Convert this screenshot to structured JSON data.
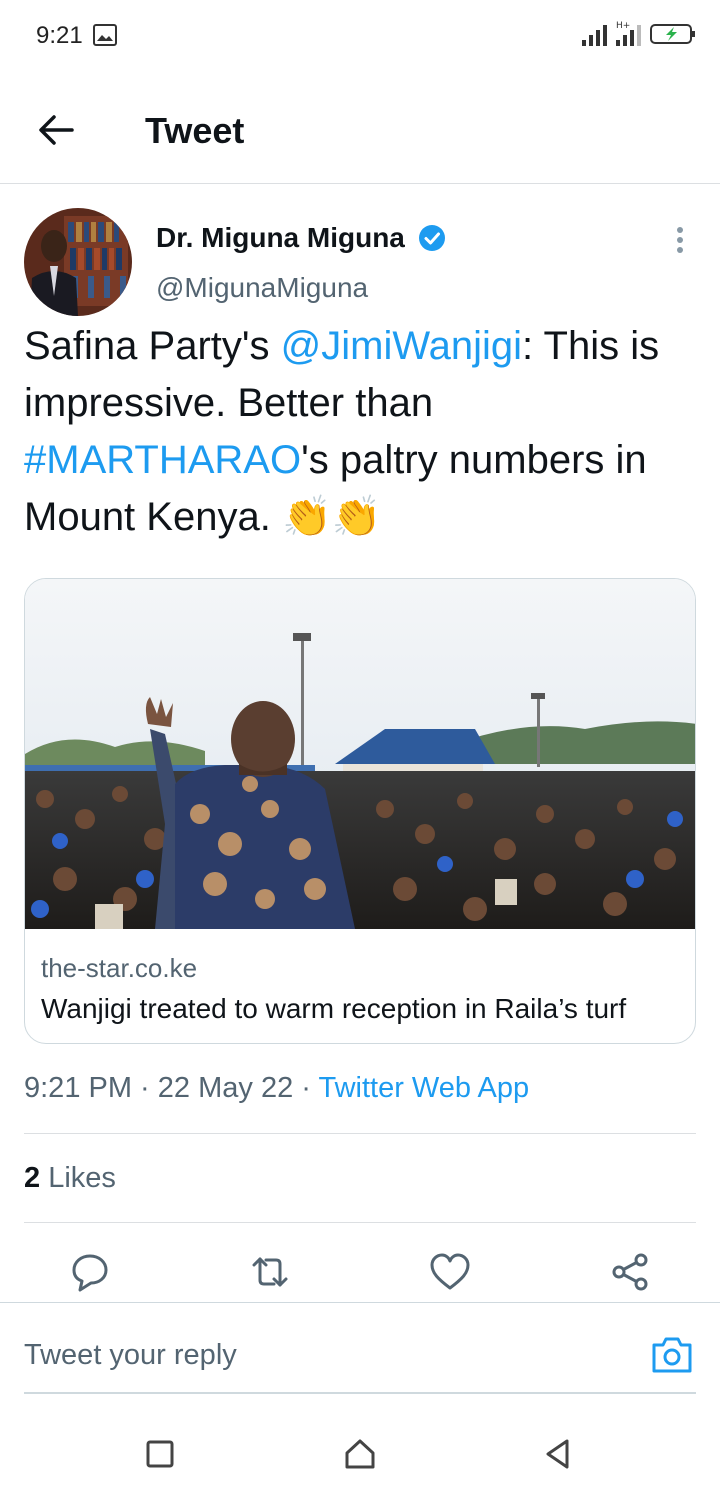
{
  "status_bar": {
    "time": "9:21",
    "icons": [
      "gallery-icon",
      "signal-icon",
      "signal-hplus-icon",
      "battery-charging-icon"
    ]
  },
  "header": {
    "title": "Tweet",
    "back_icon": "arrow-left-icon"
  },
  "tweet": {
    "author_name": "Dr. Miguna Miguna",
    "author_handle": "@MigunaMiguna",
    "verified": true,
    "text_parts": {
      "p1": "Safina Party's ",
      "mention": "@JimiWanjigi",
      "p2": ": This is impressive. Better than ",
      "hashtag": "#MARTHARAO",
      "p3": "'s paltry numbers in Mount Kenya. ",
      "emoji": "👏👏"
    },
    "card": {
      "domain": "the-star.co.ke",
      "title": "Wanjigi treated to warm reception in Raila’s turf"
    },
    "time": "9:21 PM",
    "separator": " · ",
    "date": "22 May 22",
    "source": "Twitter Web App",
    "likes_count": "2",
    "likes_label": " Likes"
  },
  "actions": [
    "reply-icon",
    "retweet-icon",
    "like-icon",
    "share-icon"
  ],
  "reply": {
    "placeholder": "Tweet your reply"
  },
  "colors": {
    "accent": "#1d9bf0",
    "text": "#0f1419",
    "secondary": "#536471",
    "border": "#cfd9de"
  }
}
